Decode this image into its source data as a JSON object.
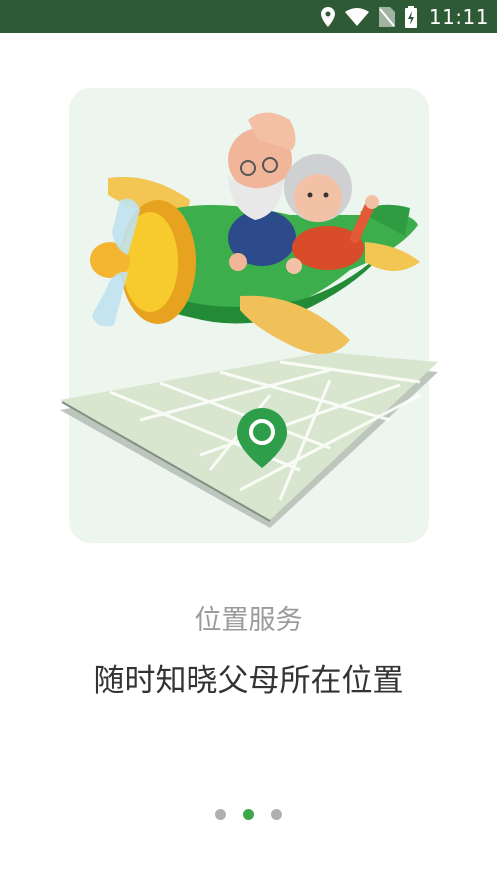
{
  "status_bar": {
    "time": "11:11",
    "icons": [
      "location-icon",
      "wifi-icon",
      "no-sim-icon",
      "battery-charging-icon"
    ]
  },
  "onboarding": {
    "illustration": "elderly-couple-airplane-map",
    "subtitle": "位置服务",
    "headline": "随时知晓父母所在位置"
  },
  "pager": {
    "page_count": 3,
    "active_index": 1
  },
  "colors": {
    "status_bar": "#2f5a36",
    "accent_green": "#3fa64b",
    "subtitle_text": "#9b9b9b",
    "headline_text": "#333333",
    "card_background": "#edf5ef"
  }
}
